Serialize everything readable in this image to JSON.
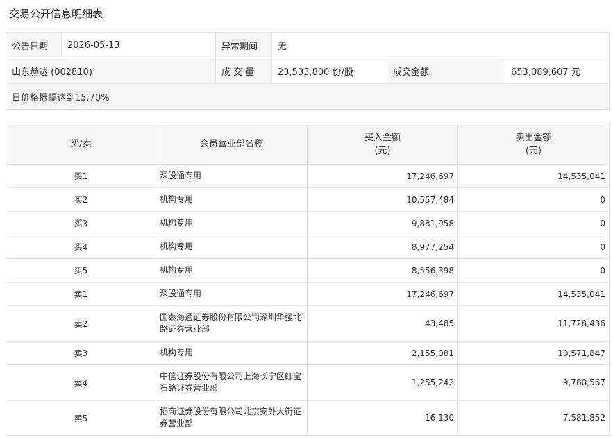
{
  "page_title": "交易公开信息明细表",
  "info": {
    "announce_date_label": "公告日期",
    "announce_date_value": "2026-05-13",
    "abnormal_period_label": "异常期间",
    "abnormal_period_value": "无",
    "stock_name": "山东赫达 (002810)",
    "volume_label": "成 交 量",
    "volume_value": "23,533,800 份/股",
    "amount_label": "成交金额",
    "amount_value": "653,089,607 元",
    "reason": "日价格振幅达到15.70%"
  },
  "detail": {
    "headers": {
      "side": "买/卖",
      "member": "会员营业部名称",
      "buy_amount_line1": "买入金额",
      "buy_amount_line2": "(元)",
      "sell_amount_line1": "卖出金额",
      "sell_amount_line2": "(元)"
    },
    "rows": [
      {
        "side": "买1",
        "member": "深股通专用",
        "buy": "17,246,697",
        "sell": "14,535,041"
      },
      {
        "side": "买2",
        "member": "机构专用",
        "buy": "10,557,484",
        "sell": "0"
      },
      {
        "side": "买3",
        "member": "机构专用",
        "buy": "9,881,958",
        "sell": "0"
      },
      {
        "side": "买4",
        "member": "机构专用",
        "buy": "8,977,254",
        "sell": "0"
      },
      {
        "side": "买5",
        "member": "机构专用",
        "buy": "8,556,398",
        "sell": "0"
      },
      {
        "side": "卖1",
        "member": "深股通专用",
        "buy": "17,246,697",
        "sell": "14,535,041"
      },
      {
        "side": "卖2",
        "member": "国泰海通证券股份有限公司深圳华强北路证券营业部",
        "buy": "43,485",
        "sell": "11,728,436"
      },
      {
        "side": "卖3",
        "member": "机构专用",
        "buy": "2,155,081",
        "sell": "10,571,847"
      },
      {
        "side": "卖4",
        "member": "中信证券股份有限公司上海长宁区红宝石路证券营业部",
        "buy": "1,255,242",
        "sell": "9,780,567"
      },
      {
        "side": "卖5",
        "member": "招商证券股份有限公司北京安外大街证券营业部",
        "buy": "16,130",
        "sell": "7,581,852"
      }
    ]
  }
}
